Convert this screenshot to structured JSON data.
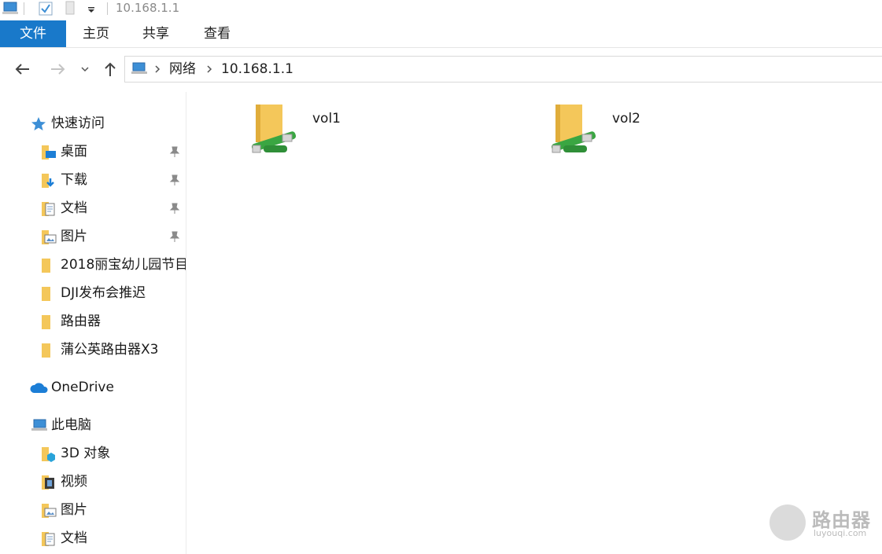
{
  "window": {
    "title": "10.168.1.1"
  },
  "ribbon": {
    "tabs": [
      {
        "label": "文件"
      },
      {
        "label": "主页"
      },
      {
        "label": "共享"
      },
      {
        "label": "查看"
      }
    ]
  },
  "address": {
    "crumbs": [
      "网络",
      "10.168.1.1"
    ]
  },
  "sidebar": {
    "quick_access": {
      "label": "快速访问"
    },
    "pinned": [
      {
        "label": "桌面",
        "icon": "desktop-folder-icon"
      },
      {
        "label": "下载",
        "icon": "downloads-folder-icon"
      },
      {
        "label": "文档",
        "icon": "documents-folder-icon"
      },
      {
        "label": "图片",
        "icon": "pictures-folder-icon"
      }
    ],
    "recent": [
      {
        "label": "2018丽宝幼儿园节目"
      },
      {
        "label": "DJI发布会推迟"
      },
      {
        "label": "路由器"
      },
      {
        "label": "蒲公英路由器X3"
      }
    ],
    "onedrive": {
      "label": "OneDrive"
    },
    "this_pc": {
      "label": "此电脑"
    },
    "pc_items": [
      {
        "label": "3D 对象",
        "icon": "3d-objects-icon"
      },
      {
        "label": "视频",
        "icon": "videos-folder-icon"
      },
      {
        "label": "图片",
        "icon": "pictures-folder-icon"
      },
      {
        "label": "文档",
        "icon": "documents-folder-icon"
      }
    ]
  },
  "content": {
    "shares": [
      {
        "label": "vol1"
      },
      {
        "label": "vol2"
      }
    ]
  },
  "watermark": {
    "text": "路由器",
    "sub": "luyouqi.com"
  },
  "colors": {
    "accent": "#1979ca",
    "folder": "#f4c75a",
    "share_link": "#3aa642"
  }
}
